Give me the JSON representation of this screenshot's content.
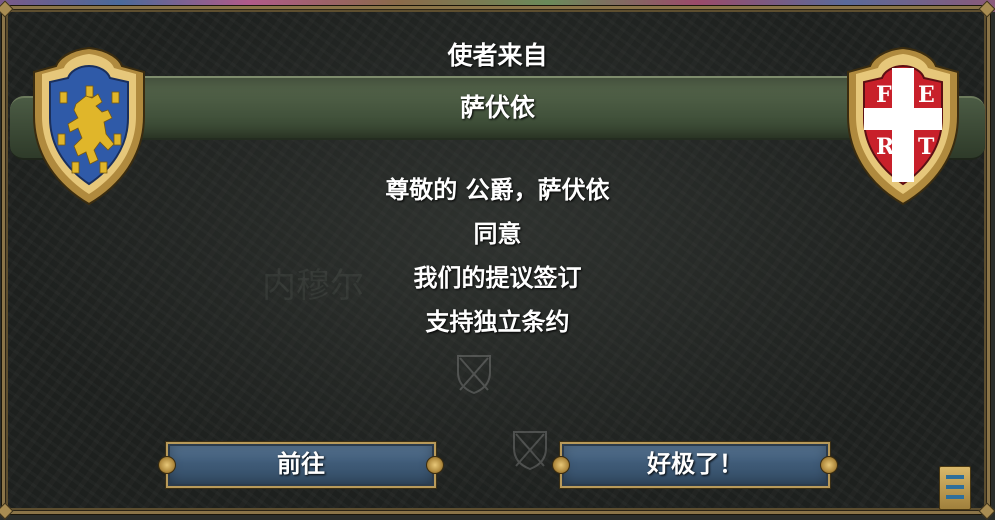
{
  "dialog": {
    "header_title": "使者来自",
    "sender_name": "萨伏依",
    "message_lines": [
      "尊敬的 公爵，萨伏依",
      "同意",
      "我们的提议签订",
      "支持独立条约"
    ],
    "buttons": {
      "go_label": "前往",
      "great_label": "好极了！"
    },
    "left_shield": {
      "icon": "lion-rampant-coat-of-arms",
      "field_color": "#2f5aa8",
      "charge_color": "#e0b62a"
    },
    "right_shield": {
      "icon": "savoy-cross-coat-of-arms",
      "field_color": "#c8202a",
      "cross_color": "#ffffff",
      "letters": [
        "F",
        "E",
        "R",
        "T"
      ]
    },
    "background_watermark": "内穆尔",
    "corner_icon": "ledger-icon"
  }
}
